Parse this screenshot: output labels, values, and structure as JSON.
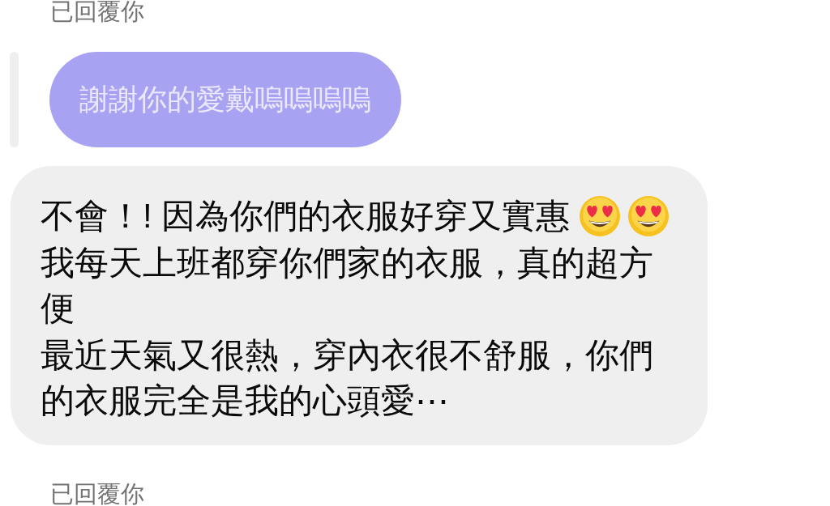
{
  "messages": [
    {
      "kind": "status",
      "text": "已回覆你"
    },
    {
      "kind": "quoted_reply",
      "text": "謝謝你的愛戴嗚嗚嗚嗚"
    },
    {
      "kind": "received",
      "paragraphs": [
        {
          "text": "不會！! 因為你們的衣服好穿又實惠",
          "emojis": [
            {
              "kind": "heart_eyes"
            },
            {
              "kind": "heart_eyes"
            }
          ]
        },
        {
          "text": "我每天上班都穿你們家的衣服，真的超方便"
        },
        {
          "text": "最近天氣又很熱，穿內衣很不舒服，你們的衣服完全是我的心頭愛⋯"
        }
      ]
    },
    {
      "kind": "status",
      "text": "已回覆你"
    }
  ]
}
